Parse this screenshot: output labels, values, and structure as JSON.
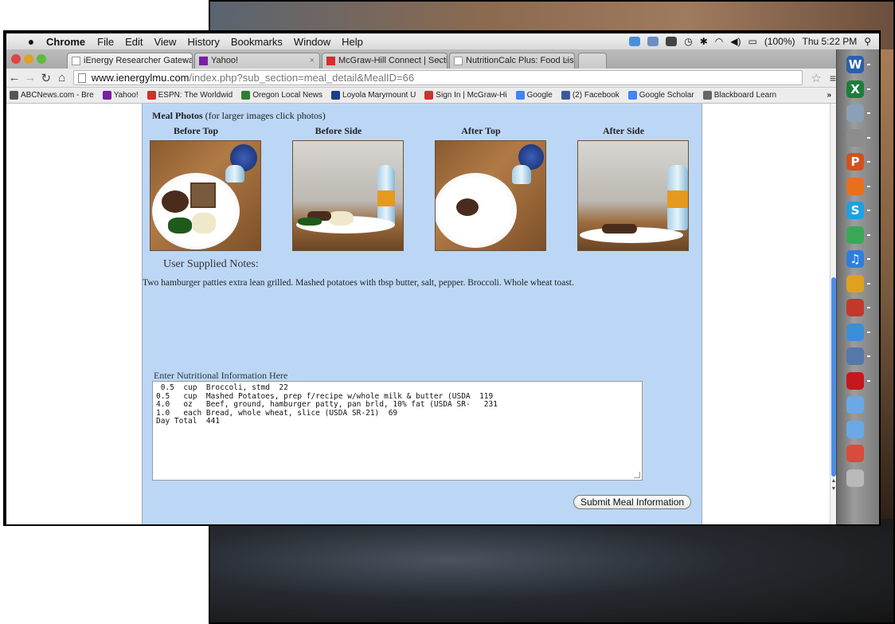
{
  "menubar": {
    "app": "Chrome",
    "menus": [
      "File",
      "Edit",
      "View",
      "History",
      "Bookmarks",
      "Window",
      "Help"
    ],
    "battery": "(100%)",
    "clock": "Thu 5:22 PM"
  },
  "tabs": [
    {
      "label": "iEnergy Researcher Gateway"
    },
    {
      "label": "Yahoo!"
    },
    {
      "label": "McGraw-Hill Connect | Secti"
    },
    {
      "label": "NutritionCalc Plus: Food Lis"
    }
  ],
  "address": {
    "host": "www.ienergylmu.com",
    "path": "/index.php?sub_section=meal_detail&MealID=66"
  },
  "bookmarks": [
    {
      "label": "ABCNews.com - Bre",
      "color": "#555555"
    },
    {
      "label": "Yahoo!",
      "color": "#7b1fa2"
    },
    {
      "label": "ESPN: The Worldwid",
      "color": "#d32f2f"
    },
    {
      "label": "Oregon Local News",
      "color": "#2e7d32"
    },
    {
      "label": "Loyola Marymount U",
      "color": "#1a3c8a"
    },
    {
      "label": "Sign In | McGraw-Hi",
      "color": "#d32f2f"
    },
    {
      "label": "Google",
      "color": "#4285f4"
    },
    {
      "label": "(2) Facebook",
      "color": "#3b5998"
    },
    {
      "label": "Google Scholar",
      "color": "#4285f4"
    },
    {
      "label": "Blackboard Learn",
      "color": "#666666"
    }
  ],
  "bookmarks_more": "»",
  "meal": {
    "photos_heading": "Meal Photos",
    "photos_hint": "(for larger images click photos)",
    "photo_labels": [
      "Before Top",
      "Before Side",
      "After Top",
      "After Side"
    ],
    "notes_title": "User Supplied Notes:",
    "notes_text": "Two hamburger patties extra lean grilled. Mashed potatoes with tbsp butter, salt, pepper. Broccoli. Whole wheat toast."
  },
  "entry": {
    "label": "Enter Nutritional Information Here",
    "lines": [
      " 0.5  cup  Broccoli, stmd  22",
      "0.5   cup  Mashed Potatoes, prep f/recipe w/whole milk & butter (USDA  119",
      "4.0   oz   Beef, ground, hamburger patty, pan brld, 10% fat (USDA SR-   231",
      "1.0   each Bread, whole wheat, slice (USDA SR-21)  69",
      "Day Total  441"
    ]
  },
  "submit_label": "Submit Meal Information",
  "dock": [
    {
      "icon": "word-icon",
      "glyph": "W",
      "color": "#2b5fad"
    },
    {
      "icon": "excel-icon",
      "glyph": "X",
      "color": "#1e7d3a"
    },
    {
      "icon": "preview-icon",
      "glyph": "",
      "color": "#8aa0b8"
    },
    {
      "icon": "settings-icon",
      "glyph": "",
      "color": "#8c8c8c"
    },
    {
      "icon": "powerpoint-icon",
      "glyph": "P",
      "color": "#d2521d"
    },
    {
      "icon": "firefox-icon",
      "glyph": "",
      "color": "#e8701a"
    },
    {
      "icon": "skype-icon",
      "glyph": "S",
      "color": "#1da1e2"
    },
    {
      "icon": "chrome-icon",
      "glyph": "",
      "color": "#3aa757"
    },
    {
      "icon": "itunes-icon",
      "glyph": "♫",
      "color": "#2f7de0"
    },
    {
      "icon": "lock-icon",
      "glyph": "",
      "color": "#e0a020"
    },
    {
      "icon": "photo-booth-icon",
      "glyph": "",
      "color": "#c0392b"
    },
    {
      "icon": "safari-icon",
      "glyph": "",
      "color": "#3b8fd6"
    },
    {
      "icon": "alarm-icon",
      "glyph": "",
      "color": "#5577aa"
    },
    {
      "icon": "acrobat-icon",
      "glyph": "",
      "color": "#c4181e"
    },
    {
      "icon": "folder-icon",
      "glyph": "",
      "color": "#6aa8e6"
    },
    {
      "icon": "folder-icon-2",
      "glyph": "",
      "color": "#6aa8e6"
    },
    {
      "icon": "slides-icon",
      "glyph": "",
      "color": "#d94b3d"
    },
    {
      "icon": "trash-icon",
      "glyph": "",
      "color": "#b9b9b9"
    }
  ]
}
